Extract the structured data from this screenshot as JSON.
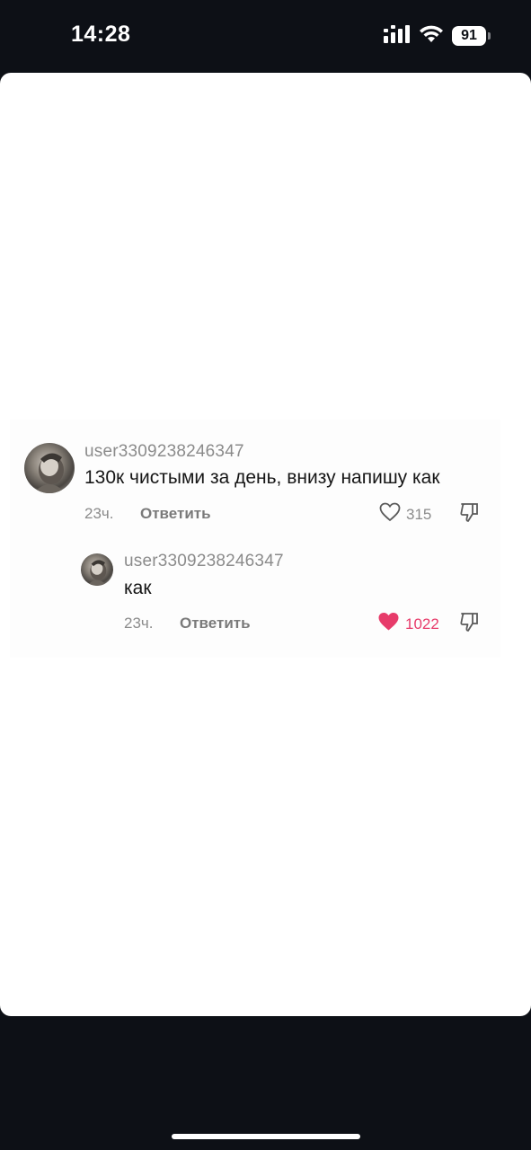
{
  "status_bar": {
    "time": "14:28",
    "battery_level": "91",
    "icons": [
      "signal-icon",
      "wifi-icon",
      "battery-icon"
    ]
  },
  "comments": [
    {
      "username": "user3309238246347",
      "text": "130к чистыми за день, внизу напишу как",
      "time": "23ч.",
      "reply_label": "Ответить",
      "likes": "315",
      "liked": false
    },
    {
      "username": "user3309238246347",
      "text": "как",
      "time": "23ч.",
      "reply_label": "Ответить",
      "likes": "1022",
      "liked": true
    }
  ],
  "colors": {
    "background": "#0d1016",
    "card": "#ffffff",
    "like_active": "#e73b6a",
    "muted_text": "#8b8b8b"
  }
}
